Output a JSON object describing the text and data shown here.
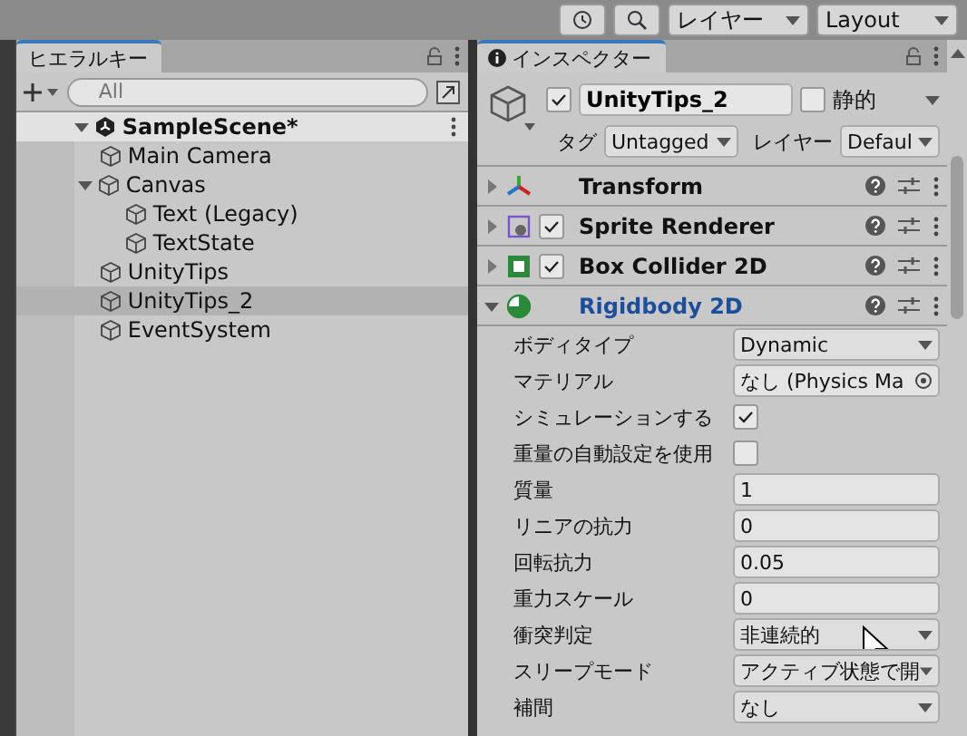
{
  "toolbar": {
    "icon_buttons": [
      {
        "kind": "history"
      },
      {
        "kind": "search"
      }
    ],
    "dropdowns": [
      "レイヤー",
      "Layout"
    ]
  },
  "hierarchy": {
    "title": "ヒエラルキー",
    "search": {
      "placeholder": "All"
    },
    "scene": {
      "name": "SampleScene*",
      "expanded": true
    },
    "items": [
      {
        "name": "Main Camera",
        "selected": false
      },
      {
        "name": "Canvas",
        "selected": false,
        "expanded": true,
        "children": [
          {
            "name": "Text (Legacy)",
            "selected": false
          },
          {
            "name": "TextState",
            "selected": false
          }
        ]
      },
      {
        "name": "UnityTips",
        "selected": false
      },
      {
        "name": "UnityTips_2",
        "selected": true
      },
      {
        "name": "EventSystem",
        "selected": false
      }
    ]
  },
  "inspector": {
    "title": "インスペクター",
    "object": {
      "active": true,
      "name": "UnityTips_2",
      "static": false,
      "static_label": "静的",
      "tag_label": "タグ",
      "tag": "Untagged",
      "layer_label": "レイヤー",
      "layer": "Defaul"
    },
    "components": [
      {
        "name": "Transform",
        "kind": "transform",
        "expanded": false,
        "selected": false
      },
      {
        "name": "Sprite Renderer",
        "kind": "sprite",
        "enabled": true,
        "expanded": false,
        "selected": false
      },
      {
        "name": "Box Collider 2D",
        "kind": "box",
        "enabled": true,
        "expanded": false,
        "selected": false
      },
      {
        "name": "Rigidbody 2D",
        "kind": "rigidbody",
        "expanded": true,
        "selected": true
      }
    ],
    "properties": [
      {
        "label": "ボディタイプ",
        "kind": "dropdown",
        "value": "Dynamic"
      },
      {
        "label": "マテリアル",
        "kind": "object",
        "value": "なし (Physics Ma"
      },
      {
        "label": "シミュレーションする",
        "kind": "checkbox",
        "checked": true
      },
      {
        "label": "重量の自動設定を使用",
        "kind": "checkbox",
        "checked": false
      },
      {
        "label": "質量",
        "kind": "number",
        "value": "1"
      },
      {
        "label": "リニアの抗力",
        "kind": "number",
        "value": "0"
      },
      {
        "label": "回転抗力",
        "kind": "number",
        "value": "0.05"
      },
      {
        "label": "重力スケール",
        "kind": "number",
        "value": "0"
      },
      {
        "label": "衝突判定",
        "kind": "dropdown",
        "value": "非連続的"
      },
      {
        "label": "スリープモード",
        "kind": "dropdown",
        "value": "アクティブ状態で開"
      },
      {
        "label": "補間",
        "kind": "dropdown",
        "value": "なし"
      }
    ]
  }
}
